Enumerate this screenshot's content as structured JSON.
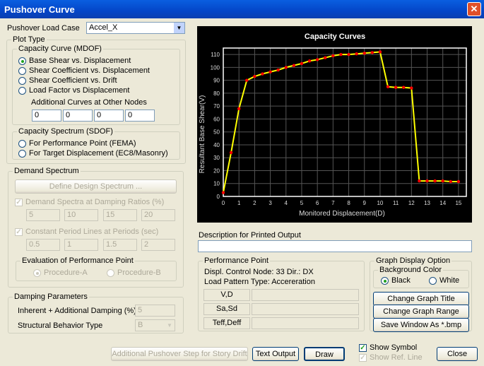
{
  "window": {
    "title": "Pushover Curve",
    "close": "✕"
  },
  "load_case": {
    "label": "Pushover Load Case",
    "value": "Accel_X"
  },
  "plot_type": {
    "label": "Plot Type",
    "mdof": {
      "label": "Capacity Curve (MDOF)",
      "options": [
        "Base Shear vs. Displacement",
        "Shear Coefficient vs. Displacement",
        "Shear Coefficient vs. Drift",
        "Load Factor vs Displacement"
      ],
      "selected": 0,
      "additional_label": "Additional Curves at Other Nodes",
      "additional_values": [
        "0",
        "0",
        "0",
        "0"
      ]
    },
    "sdof": {
      "label": "Capacity Spectrum (SDOF)",
      "options": [
        "For Performance Point (FEMA)",
        "For Target Displacement (EC8/Masonry)"
      ]
    }
  },
  "demand": {
    "label": "Demand Spectrum",
    "define_button": "Define Design Spectrum ...",
    "damping_label": "Demand Spectra at Damping Ratios (%)",
    "damping_values": [
      "5",
      "10",
      "15",
      "20"
    ],
    "period_label": "Constant Period Lines at Periods (sec)",
    "period_values": [
      "0.5",
      "1",
      "1.5",
      "2"
    ],
    "evaluation": {
      "label": "Evaluation of Performance Point",
      "options": [
        "Procedure-A",
        "Procedure-B"
      ]
    }
  },
  "damping": {
    "label": "Damping Parameters",
    "inherent_label": "Inherent + Additional Damping (%)",
    "inherent_value": "5",
    "behavior_label": "Structural Behavior Type",
    "behavior_value": "B"
  },
  "description": {
    "label": "Description for Printed Output",
    "value": ""
  },
  "performance": {
    "label": "Performance Point",
    "control_node": "Displ. Control Node: 33  Dir.: DX",
    "load_pattern": "Load Pattern Type: Accereration",
    "rows": [
      "V,D",
      "Sa,Sd",
      "Teff,Deff"
    ]
  },
  "graph_option": {
    "label": "Graph Display Option",
    "bg_label": "Background Color",
    "bg_options": [
      "Black",
      "White"
    ],
    "buttons": [
      "Change Graph Title",
      "Change Graph Range",
      "Save Window As *.bmp"
    ]
  },
  "bottom": {
    "additional_step": "Additional Pushover Step for Story Drift",
    "text_output": "Text Output",
    "draw": "Draw",
    "show_symbol": "Show Symbol",
    "show_ref_line": "Show Ref. Line",
    "close": "Close"
  },
  "chart_data": {
    "type": "line",
    "title": "Capacity Curves",
    "xlabel": "Monitored Displacement(D)",
    "ylabel": "Resultant Base Shear(V)",
    "xlim": [
      0,
      15.5
    ],
    "ylim": [
      0,
      115
    ],
    "xticks": [
      0,
      1,
      2,
      3,
      4,
      5,
      6,
      7,
      8,
      9,
      10,
      11,
      12,
      13,
      14,
      15
    ],
    "yticks": [
      0,
      10,
      20,
      30,
      40,
      50,
      60,
      70,
      80,
      90,
      100,
      110
    ],
    "grid": true,
    "series": [
      {
        "name": "Capacity Curve",
        "color": "#ffff00",
        "marker_color": "#ff0000",
        "x": [
          0,
          0.5,
          1,
          1.5,
          2,
          2.5,
          3,
          3.5,
          4,
          4.5,
          5,
          5.5,
          6,
          6.5,
          7,
          7.5,
          8,
          8.5,
          9,
          9.5,
          10,
          10.5,
          11,
          11.5,
          12,
          12.5,
          13,
          13.5,
          14,
          14.5,
          15
        ],
        "y": [
          3,
          34,
          68,
          90,
          93,
          95,
          96.5,
          98,
          100,
          101.5,
          103,
          105,
          106,
          107.5,
          109,
          110,
          110,
          110.5,
          111,
          111.5,
          112,
          85,
          84.5,
          84.5,
          84,
          12,
          12,
          12,
          12,
          11.5,
          11.5
        ]
      }
    ]
  }
}
